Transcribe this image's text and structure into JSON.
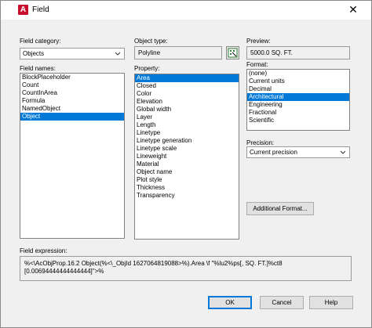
{
  "window": {
    "title": "Field",
    "app_icon": "A"
  },
  "field_category": {
    "label": "Field category:",
    "selected": "Objects"
  },
  "field_names": {
    "label": "Field names:",
    "items": [
      "BlockPlaceholder",
      "Count",
      "CountInArea",
      "Formula",
      "NamedObject",
      "Object"
    ],
    "selected_index": 5
  },
  "object_type": {
    "label": "Object type:",
    "value": "Polyline"
  },
  "property": {
    "label": "Property:",
    "items": [
      "Area",
      "Closed",
      "Color",
      "Elevation",
      "Global width",
      "Layer",
      "Length",
      "Linetype",
      "Linetype generation",
      "Linetype scale",
      "Lineweight",
      "Material",
      "Object name",
      "Plot style",
      "Thickness",
      "Transparency"
    ],
    "selected_index": 0
  },
  "preview": {
    "label": "Preview:",
    "value": "5000.0 SQ. FT."
  },
  "format": {
    "label": "Format:",
    "items": [
      "(none)",
      "Current units",
      "Decimal",
      "Architectural",
      "Engineering",
      "Fractional",
      "Scientific"
    ],
    "selected_index": 3
  },
  "precision": {
    "label": "Precision:",
    "selected": "Current precision"
  },
  "additional_format_button": "Additional Format...",
  "field_expression": {
    "label": "Field expression:",
    "line1": "%<\\AcObjProp.16.2 Object(%<\\_ObjId 1627064819088>%).Area \\f \"%lu2%ps[, SQ. FT.]%ct8",
    "line2": "[0.00694444444444444]\">%"
  },
  "buttons": {
    "ok": "OK",
    "cancel": "Cancel",
    "help": "Help"
  },
  "colors": {
    "selection": "#0078d7",
    "app_icon": "#c8102e",
    "dialog_bg": "#f0f0f0"
  }
}
